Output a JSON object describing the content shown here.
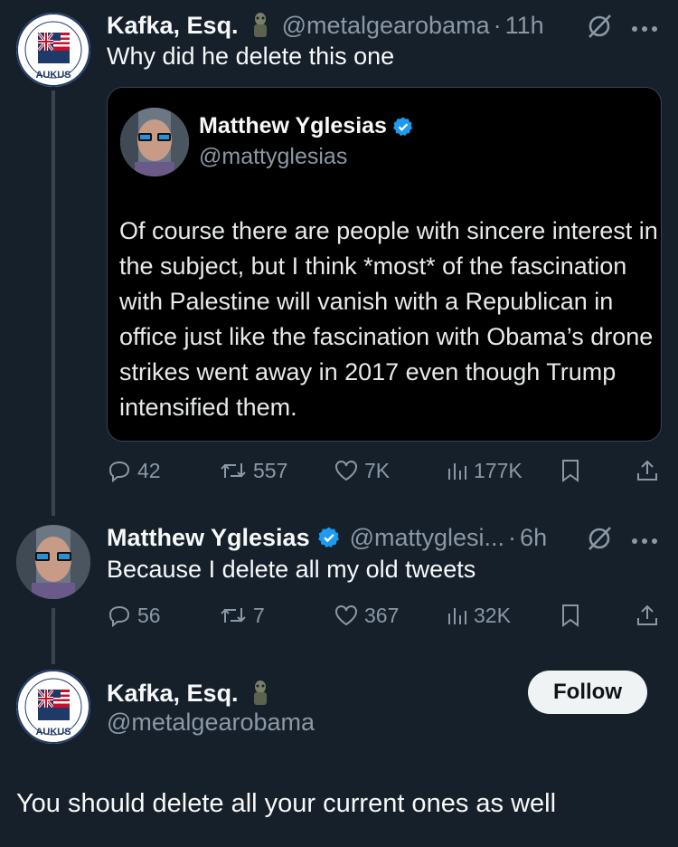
{
  "tweet1": {
    "author": {
      "name": "Kafka, Esq.",
      "handle": "@metalgearobama",
      "avatar_text": "AUKUS"
    },
    "separator": "·",
    "time": "11h",
    "text": "Why did he delete this one",
    "quoted": {
      "author": {
        "name": "Matthew Yglesias",
        "handle": "@mattyglesias"
      },
      "text": "Of course there are people with sincere interest in the subject, but I think *most* of the fascination with Palestine will vanish with a Republican in office just like the fascination with Obama’s drone strikes went away in 2017 even though Trump intensified them."
    },
    "stats": {
      "replies": "42",
      "retweets": "557",
      "likes": "7K",
      "views": "177K"
    }
  },
  "tweet2": {
    "author": {
      "name": "Matthew Yglesias",
      "handle": "@mattyglesi...",
      "verified": true
    },
    "separator": "·",
    "time": "6h",
    "text": "Because I delete all my old tweets",
    "stats": {
      "replies": "56",
      "retweets": "7",
      "likes": "367",
      "views": "32K"
    }
  },
  "tweet3": {
    "author": {
      "name": "Kafka, Esq.",
      "handle": "@metalgearobama",
      "avatar_text": "AUKUS"
    },
    "follow_label": "Follow",
    "text": "You should delete all your current ones as well"
  },
  "colors": {
    "background": "#15202b",
    "secondary_text": "#8b98a5",
    "verified_blue": "#1d9bf0",
    "follow_bg": "#eff3f4"
  }
}
